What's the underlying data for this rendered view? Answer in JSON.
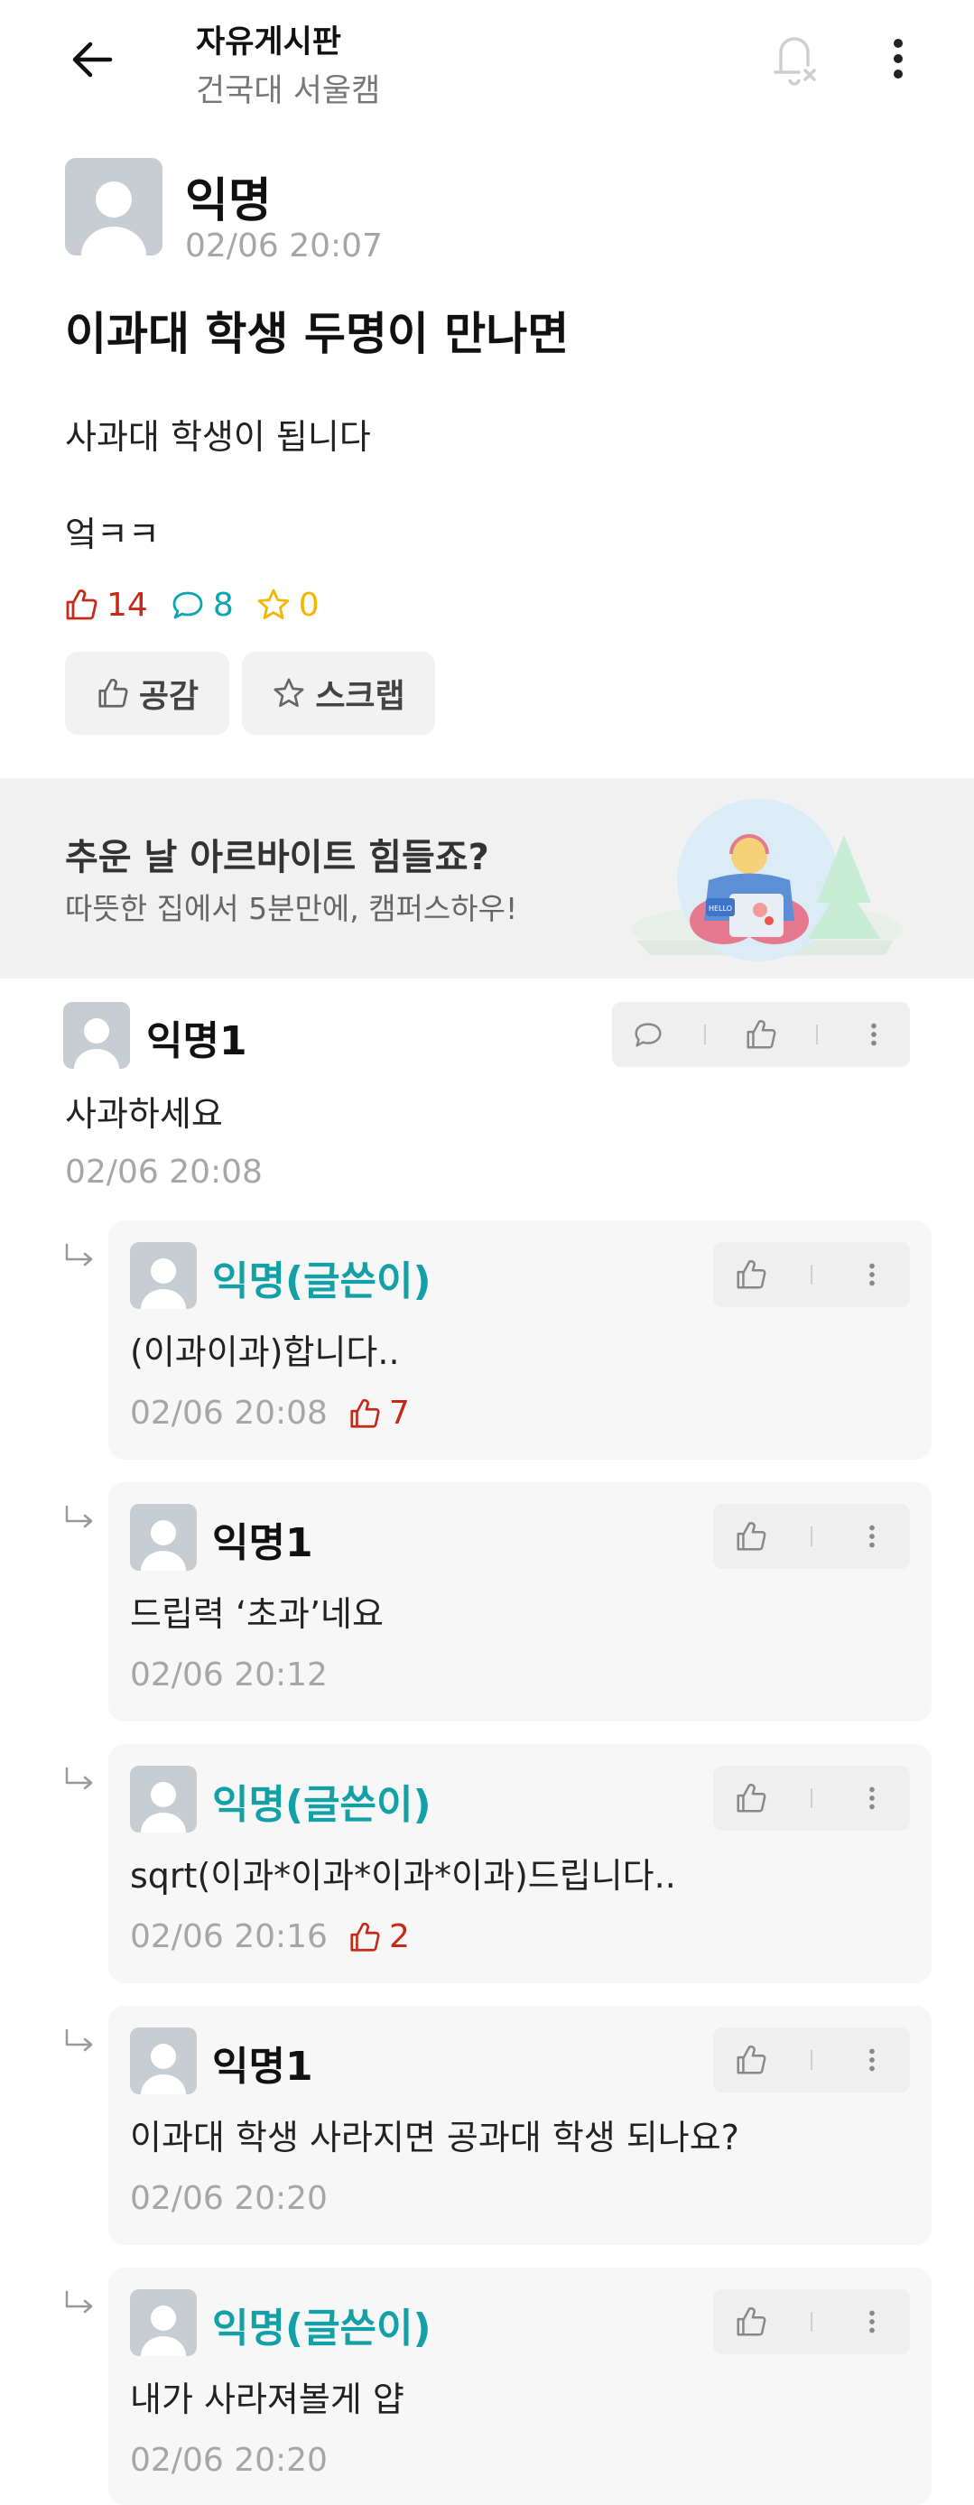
{
  "header": {
    "board_title": "자유게시판",
    "school": "건국대 서울캠",
    "icons": [
      "back-arrow-icon",
      "notification-off-icon",
      "more-vertical-icon"
    ]
  },
  "post": {
    "author": "익명",
    "time": "02/06 20:07",
    "title": "이과대 학생 두명이 만나면",
    "body_line1": "사과대 학생이 됩니다",
    "body_line2": "엌ㅋㅋ",
    "likes": "14",
    "comments": "8",
    "scraps": "0",
    "like_button": "공감",
    "scrap_button": "스크랩"
  },
  "ad": {
    "title": "추운 날 아르바이트 힘들죠?",
    "subtitle": "따뜻한 집에서 5분만에, 캠퍼스하우!",
    "badge_text": "HELLO"
  },
  "comments": [
    {
      "author": "익명1",
      "text": "사과하세요",
      "time": "02/06 20:08"
    }
  ],
  "replies": [
    {
      "author": "익명(글쓴이)",
      "text": "(이과이과)합니다..",
      "time": "02/06 20:08",
      "likes": "7"
    },
    {
      "author": "익명1",
      "text": "드립력 ‘초과’네요",
      "time": "02/06 20:12"
    },
    {
      "author": "익명(글쓴이)",
      "text": "sqrt(이과*이과*이과*이과)드립니다..",
      "time": "02/06 20:16",
      "likes": "2"
    },
    {
      "author": "익명1",
      "text": "이과대 학생 사라지면 공과대 학생 되나요?",
      "time": "02/06 20:20"
    },
    {
      "author": "익명(글쓴이)",
      "text": "내가 사라져볼게 얍",
      "time": "02/06 20:20"
    }
  ],
  "colors": {
    "accent_teal": "#13a0a6",
    "like_red": "#c62917",
    "comment_teal": "#0ca5b0",
    "scrap_yellow": "#f2b700"
  }
}
